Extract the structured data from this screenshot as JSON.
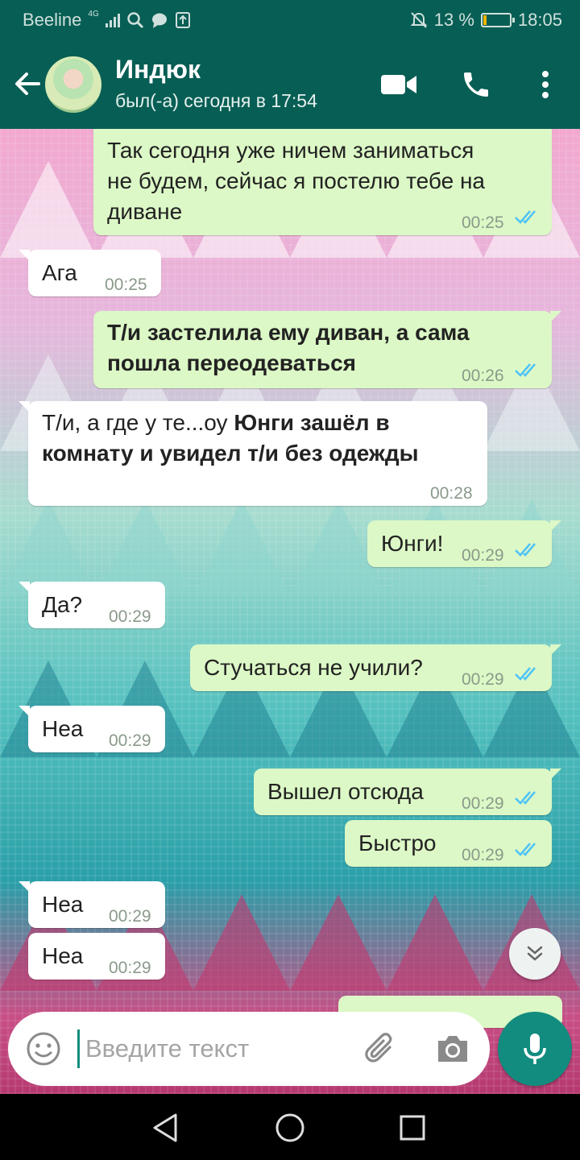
{
  "status_bar": {
    "carrier": "Beeline",
    "network": "4G",
    "battery_text": "13 %",
    "battery_level": 0.13,
    "time": "18:05",
    "icons": [
      "signal-icon",
      "search-icon",
      "chat-bubble-icon",
      "upload-icon",
      "mute-bell-icon",
      "battery-icon"
    ]
  },
  "header": {
    "contact_name": "Индюк",
    "last_seen": "был(-а) сегодня в 17:54",
    "icons": [
      "back-arrow-icon",
      "avatar",
      "video-call-icon",
      "phone-icon",
      "more-icon"
    ]
  },
  "messages": [
    {
      "dir": "out",
      "lines": [
        "Так сегодня уже ничем заниматься",
        "не будем, сейчас я постелю тебе на",
        "диване"
      ],
      "time": "00:25",
      "read": true
    },
    {
      "dir": "in",
      "text": "Ага",
      "time": "00:25"
    },
    {
      "dir": "out",
      "lines": [
        "Т/и застелила ему диван, а сама",
        "пошла переодеваться"
      ],
      "time": "00:26",
      "read": true,
      "bold": true
    },
    {
      "dir": "in",
      "plain": "Т/и, а где у те...оу ",
      "bold1": "Юнги зашёл в",
      "line2": "комнату и увидел т/и без одежды",
      "time": "00:28"
    },
    {
      "dir": "out",
      "text": "Юнги!",
      "time": "00:29",
      "read": true
    },
    {
      "dir": "in",
      "text": "Да?",
      "time": "00:29"
    },
    {
      "dir": "out",
      "text": "Стучаться не учили?",
      "time": "00:29",
      "read": true
    },
    {
      "dir": "in",
      "text": "Неа",
      "time": "00:29"
    },
    {
      "dir": "out",
      "text": "Вышел отсюда",
      "time": "00:29",
      "read": true
    },
    {
      "dir": "out",
      "text": "Быстро",
      "time": "00:29",
      "read": true
    },
    {
      "dir": "in",
      "text": "Неа",
      "time": "00:29"
    },
    {
      "dir": "in",
      "text": "Неа",
      "time": "00:29"
    }
  ],
  "composer": {
    "placeholder": "Введите текст",
    "value": "",
    "icons": [
      "emoji-icon",
      "attach-icon",
      "camera-icon",
      "mic-icon",
      "scroll-down-icon"
    ]
  },
  "colors": {
    "header": "#075e54",
    "accent": "#128c7e",
    "outgoing_bubble": "#dcf8c6",
    "incoming_bubble": "#ffffff",
    "read_ticks": "#4fc3f7"
  },
  "nav": {
    "icons": [
      "back-triangle-icon",
      "home-circle-icon",
      "recents-square-icon"
    ]
  }
}
